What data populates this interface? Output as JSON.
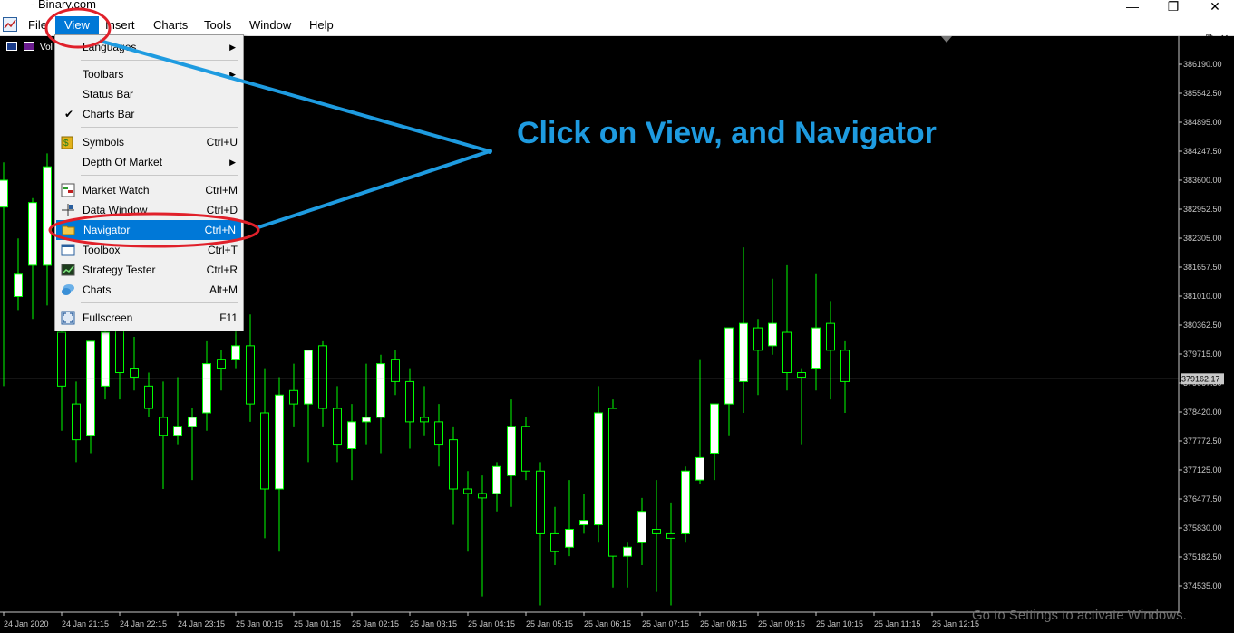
{
  "window": {
    "title": "- Binary.com",
    "buttons": {
      "minimize": "—",
      "restore": "❐",
      "close": "✕"
    }
  },
  "menu": {
    "items": [
      {
        "label": "File"
      },
      {
        "label": "View"
      },
      {
        "label": "Insert"
      },
      {
        "label": "Charts"
      },
      {
        "label": "Tools"
      },
      {
        "label": "Window"
      },
      {
        "label": "Help"
      }
    ],
    "active": "View"
  },
  "mdi": {
    "minimize": "–",
    "restore": "⧉",
    "close": "✕"
  },
  "chart_label": "Vol",
  "dropdown": {
    "items": [
      {
        "label": "Languages",
        "shortcut": "",
        "submenu": true,
        "icon": ""
      },
      {
        "label": "Toolbars",
        "shortcut": "",
        "submenu": true,
        "icon": ""
      },
      {
        "label": "Status Bar",
        "shortcut": "",
        "submenu": false,
        "icon": ""
      },
      {
        "label": "Charts Bar",
        "shortcut": "",
        "submenu": false,
        "icon": "check-icon"
      },
      {
        "label": "Symbols",
        "shortcut": "Ctrl+U",
        "submenu": false,
        "icon": "symbols-icon"
      },
      {
        "label": "Depth Of Market",
        "shortcut": "",
        "submenu": true,
        "icon": ""
      },
      {
        "label": "Market Watch",
        "shortcut": "Ctrl+M",
        "submenu": false,
        "icon": "market-watch-icon"
      },
      {
        "label": "Data Window",
        "shortcut": "Ctrl+D",
        "submenu": false,
        "icon": "data-window-icon"
      },
      {
        "label": "Navigator",
        "shortcut": "Ctrl+N",
        "submenu": false,
        "icon": "folder-icon"
      },
      {
        "label": "Toolbox",
        "shortcut": "Ctrl+T",
        "submenu": false,
        "icon": "toolbox-icon"
      },
      {
        "label": "Strategy Tester",
        "shortcut": "Ctrl+R",
        "submenu": false,
        "icon": "strategy-tester-icon"
      },
      {
        "label": "Chats",
        "shortcut": "Alt+M",
        "submenu": false,
        "icon": "chats-icon"
      },
      {
        "label": "Fullscreen",
        "shortcut": "F11",
        "submenu": false,
        "icon": "fullscreen-icon"
      }
    ],
    "selected": "Navigator"
  },
  "annotation": "Click on View, and Navigator",
  "watermark": "Go to Settings to activate Windows.",
  "price_axis": {
    "labels": [
      "386190.00",
      "385542.50",
      "384895.00",
      "384247.50",
      "383600.00",
      "382952.50",
      "382305.00",
      "381657.50",
      "381010.00",
      "380362.50",
      "379715.00",
      "379067.50",
      "378420.00",
      "377772.50",
      "377125.00",
      "376477.50",
      "375830.00",
      "375182.50",
      "374535.00"
    ],
    "current_price": "379162.17"
  },
  "time_axis": {
    "labels": [
      "24 Jan 2020",
      "24 Jan 21:15",
      "24 Jan 22:15",
      "24 Jan 23:15",
      "25 Jan 00:15",
      "25 Jan 01:15",
      "25 Jan 02:15",
      "25 Jan 03:15",
      "25 Jan 04:15",
      "25 Jan 05:15",
      "25 Jan 06:15",
      "25 Jan 07:15",
      "25 Jan 08:15",
      "25 Jan 09:15",
      "25 Jan 10:15",
      "25 Jan 11:15",
      "25 Jan 12:15"
    ]
  },
  "colors": {
    "bull": "#ffffff",
    "wick": "#00ff00",
    "bg": "#000000",
    "annotation": "#1e9be0",
    "highlight": "#e0202a",
    "menu_selected": "#0078d7"
  },
  "candles": [
    {
      "o": 383000,
      "h": 384000,
      "l": 379000,
      "c": 383600
    },
    {
      "o": 381000,
      "h": 382300,
      "l": 380700,
      "c": 381500
    },
    {
      "o": 381700,
      "h": 383200,
      "l": 380500,
      "c": 383100
    },
    {
      "o": 381700,
      "h": 384200,
      "l": 380800,
      "c": 383900
    },
    {
      "o": 380200,
      "h": 380600,
      "l": 378000,
      "c": 379000
    },
    {
      "o": 378600,
      "h": 379100,
      "l": 377300,
      "c": 377800
    },
    {
      "o": 377900,
      "h": 380000,
      "l": 377500,
      "c": 380000
    },
    {
      "o": 379000,
      "h": 380700,
      "l": 378700,
      "c": 380200
    },
    {
      "o": 380300,
      "h": 380500,
      "l": 378700,
      "c": 379300
    },
    {
      "o": 379400,
      "h": 380100,
      "l": 378900,
      "c": 379200
    },
    {
      "o": 379000,
      "h": 379300,
      "l": 378300,
      "c": 378500
    },
    {
      "o": 378300,
      "h": 379100,
      "l": 376700,
      "c": 377900
    },
    {
      "o": 377900,
      "h": 379200,
      "l": 377700,
      "c": 378100
    },
    {
      "o": 378100,
      "h": 378500,
      "l": 376900,
      "c": 378300
    },
    {
      "o": 378400,
      "h": 380000,
      "l": 378000,
      "c": 379500
    },
    {
      "o": 379600,
      "h": 379800,
      "l": 378900,
      "c": 379400
    },
    {
      "o": 379600,
      "h": 380600,
      "l": 379400,
      "c": 379900
    },
    {
      "o": 379900,
      "h": 380600,
      "l": 378200,
      "c": 378600
    },
    {
      "o": 378400,
      "h": 379400,
      "l": 375600,
      "c": 376700
    },
    {
      "o": 376700,
      "h": 379200,
      "l": 375300,
      "c": 378800
    },
    {
      "o": 378900,
      "h": 379500,
      "l": 378100,
      "c": 378600
    },
    {
      "o": 378600,
      "h": 379600,
      "l": 377300,
      "c": 379800
    },
    {
      "o": 379900,
      "h": 380000,
      "l": 378100,
      "c": 378500
    },
    {
      "o": 378500,
      "h": 379000,
      "l": 377300,
      "c": 377700
    },
    {
      "o": 377600,
      "h": 378600,
      "l": 376900,
      "c": 378200
    },
    {
      "o": 378200,
      "h": 379500,
      "l": 377700,
      "c": 378300
    },
    {
      "o": 378300,
      "h": 379700,
      "l": 377500,
      "c": 379500
    },
    {
      "o": 379600,
      "h": 379800,
      "l": 378800,
      "c": 379100
    },
    {
      "o": 379100,
      "h": 379400,
      "l": 377600,
      "c": 378200
    },
    {
      "o": 378300,
      "h": 379000,
      "l": 377900,
      "c": 378200
    },
    {
      "o": 378200,
      "h": 378600,
      "l": 377200,
      "c": 377700
    },
    {
      "o": 377800,
      "h": 378100,
      "l": 375900,
      "c": 376700
    },
    {
      "o": 376700,
      "h": 377100,
      "l": 375300,
      "c": 376600
    },
    {
      "o": 376600,
      "h": 377000,
      "l": 374300,
      "c": 376500
    },
    {
      "o": 376600,
      "h": 377300,
      "l": 376200,
      "c": 377200
    },
    {
      "o": 377000,
      "h": 378700,
      "l": 376300,
      "c": 378100
    },
    {
      "o": 378100,
      "h": 378300,
      "l": 376900,
      "c": 377100
    },
    {
      "o": 377100,
      "h": 377300,
      "l": 374100,
      "c": 375700
    },
    {
      "o": 375700,
      "h": 376300,
      "l": 375000,
      "c": 375300
    },
    {
      "o": 375400,
      "h": 376900,
      "l": 375200,
      "c": 375800
    },
    {
      "o": 375900,
      "h": 376600,
      "l": 375700,
      "c": 376000
    },
    {
      "o": 375900,
      "h": 379000,
      "l": 375500,
      "c": 378400
    },
    {
      "o": 378500,
      "h": 378700,
      "l": 374500,
      "c": 375200
    },
    {
      "o": 375200,
      "h": 375500,
      "l": 374500,
      "c": 375400
    },
    {
      "o": 375500,
      "h": 376500,
      "l": 375000,
      "c": 376200
    },
    {
      "o": 375800,
      "h": 376900,
      "l": 374400,
      "c": 375700
    },
    {
      "o": 375700,
      "h": 376400,
      "l": 374100,
      "c": 375600
    },
    {
      "o": 375700,
      "h": 377200,
      "l": 375500,
      "c": 377100
    },
    {
      "o": 376900,
      "h": 379600,
      "l": 376800,
      "c": 377400
    },
    {
      "o": 377500,
      "h": 378500,
      "l": 376900,
      "c": 378600
    },
    {
      "o": 378600,
      "h": 379500,
      "l": 377900,
      "c": 380300
    },
    {
      "o": 379100,
      "h": 382100,
      "l": 378400,
      "c": 380400
    },
    {
      "o": 380300,
      "h": 380500,
      "l": 378800,
      "c": 379800
    },
    {
      "o": 379900,
      "h": 381400,
      "l": 379700,
      "c": 380400
    },
    {
      "o": 380200,
      "h": 381700,
      "l": 378900,
      "c": 379300
    },
    {
      "o": 379300,
      "h": 379400,
      "l": 377700,
      "c": 379200
    },
    {
      "o": 379400,
      "h": 381500,
      "l": 378900,
      "c": 380300
    },
    {
      "o": 380400,
      "h": 380900,
      "l": 378700,
      "c": 379800
    },
    {
      "o": 379800,
      "h": 380000,
      "l": 378400,
      "c": 379100
    }
  ]
}
